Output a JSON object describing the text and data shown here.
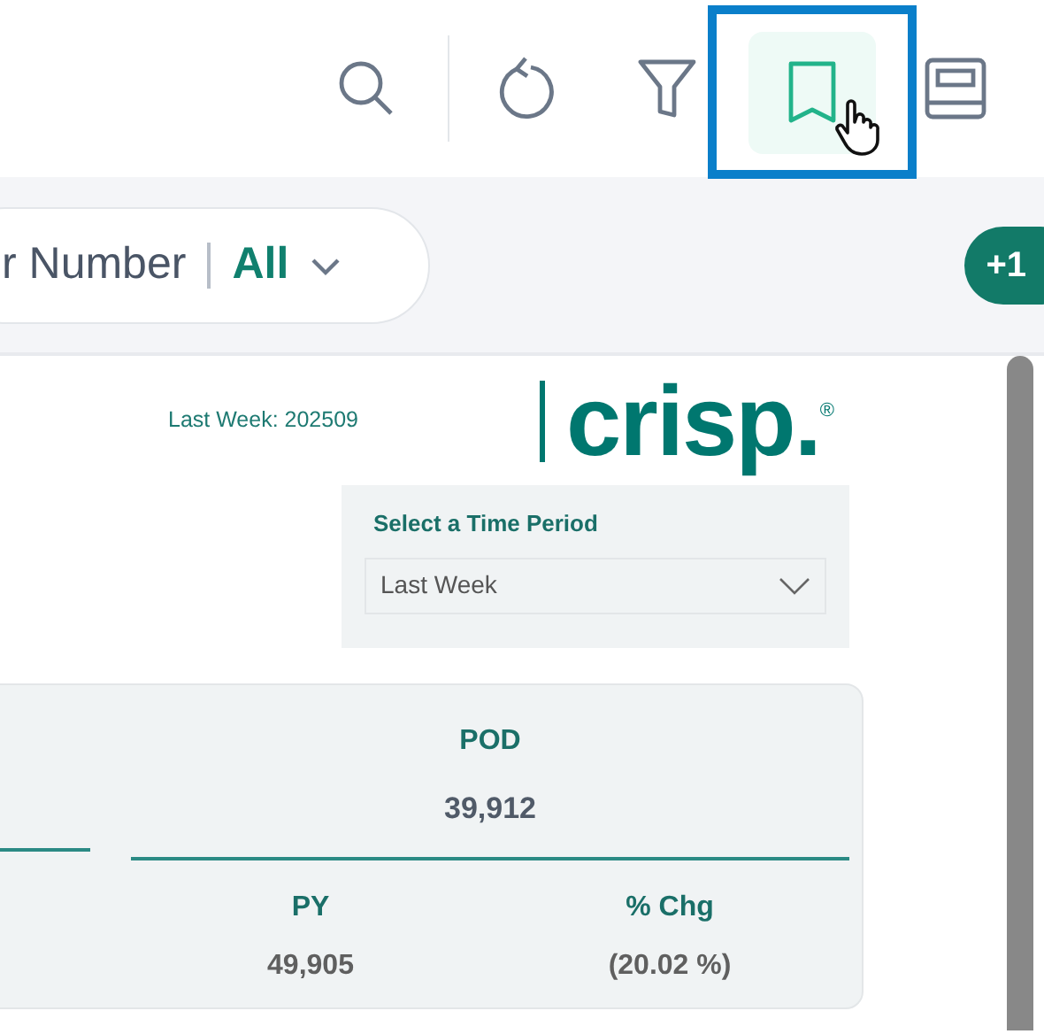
{
  "toolbar_buttons": [
    {
      "kind": "search",
      "selected": false
    },
    {
      "kind": "refresh",
      "selected": false
    },
    {
      "kind": "filter",
      "selected": false
    },
    {
      "kind": "bookmark",
      "selected": true
    },
    {
      "kind": "book",
      "selected": false
    }
  ],
  "filter_pill": {
    "label": "r Number",
    "value": "All"
  },
  "overflow_badge": "+1",
  "header": {
    "week_label": "Last Week: 202509",
    "logo": "crisp.$^{®}$"
  },
  "time_period": {
    "title": "Select a Time Period",
    "value": "Last Week"
  },
  "metric_card": {
    "title": "POD",
    "value": "39,912",
    "details": [
      {
        "label": "PY",
        "value": "49,905"
      },
      {
        "label": "% Chg",
        "value": "(20.02 %)"
      }
    ]
  }
}
